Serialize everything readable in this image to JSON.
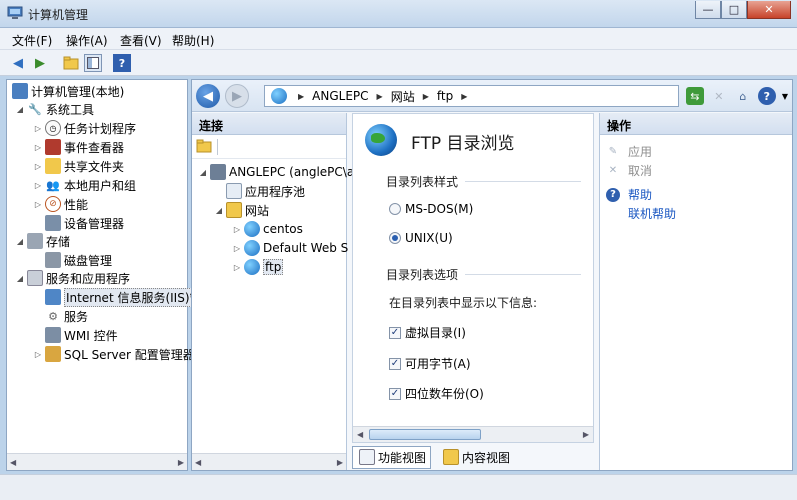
{
  "window": {
    "title": "计算机管理",
    "controls": {
      "minimize": "—",
      "maximize": "□",
      "close": "✕"
    }
  },
  "menu": [
    "文件(F)",
    "操作(A)",
    "查看(V)",
    "帮助(H)"
  ],
  "tree": {
    "root": "计算机管理(本地)",
    "system_tools": "系统工具",
    "task_scheduler": "任务计划程序",
    "event_viewer": "事件查看器",
    "shared_folders": "共享文件夹",
    "local_users": "本地用户和组",
    "performance": "性能",
    "device_manager": "设备管理器",
    "storage": "存储",
    "disk_management": "磁盘管理",
    "services_apps": "服务和应用程序",
    "iis": "Internet 信息服务(IIS)管",
    "services": "服务",
    "wmi": "WMI 控件",
    "sql_config": "SQL Server 配置管理器"
  },
  "address": {
    "crumbs": [
      "ANGLEPC",
      "网站",
      "ftp"
    ]
  },
  "connections": {
    "header": "连接",
    "server": "ANGLEPC (anglePC\\a",
    "app_pools": "应用程序池",
    "sites": "网站",
    "site_centos": "centos",
    "site_default": "Default Web S",
    "site_ftp": "ftp"
  },
  "content": {
    "title": "FTP 目录浏览",
    "style_group": "目录列表样式",
    "ms_dos": "MS-DOS(M)",
    "unix": "UNIX(U)",
    "options_group": "目录列表选项",
    "options_desc": "在目录列表中显示以下信息:",
    "virtual_dirs": "虚拟目录(I)",
    "available_bytes": "可用字节(A)",
    "four_digit_year": "四位数年份(O)"
  },
  "view_tabs": {
    "features": "功能视图",
    "content": "内容视图"
  },
  "actions": {
    "header": "操作",
    "apply": "应用",
    "cancel": "取消",
    "help": "帮助",
    "online_help": "联机帮助"
  },
  "colors": {
    "link": "#1a57c2",
    "disabled": "#8f8f8f",
    "accent": "#2a5fb0"
  }
}
